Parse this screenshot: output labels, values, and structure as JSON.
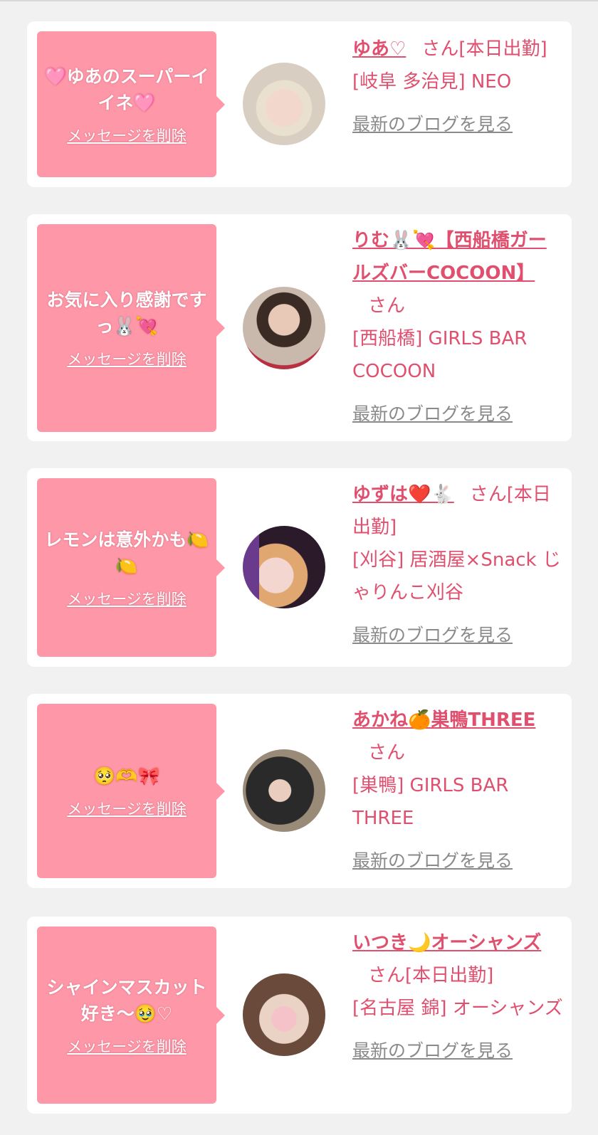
{
  "cards": [
    {
      "message": "🩷ゆあのスーパーイイネ🩷",
      "delete_label": "メッセージを削除",
      "name": "ゆあ♡",
      "suffix": "さん[本日出勤]",
      "shop": "[岐阜 多治見] NEO",
      "blog_label": "最新のブログを見る"
    },
    {
      "message": "お気に入り感謝ですっ🐰💘",
      "delete_label": "メッセージを削除",
      "name": "りむ🐰💘【西船橋ガールズバーCOCOON】",
      "suffix": "さん",
      "shop": "[西船橋] GIRLS BAR COCOON",
      "blog_label": "最新のブログを見る"
    },
    {
      "message": "レモンは意外かも🍋🍋",
      "delete_label": "メッセージを削除",
      "name": "ゆずは❤️🐇",
      "suffix": "さん[本日出勤]",
      "shop": "[刈谷] 居酒屋×Snack じゃりんこ刈谷",
      "blog_label": "最新のブログを見る"
    },
    {
      "message": "🥺🫶🎀",
      "delete_label": "メッセージを削除",
      "name": "あかね🍊巣鴨THREE",
      "suffix": "さん",
      "shop": "[巣鴨] GIRLS BAR THREE",
      "blog_label": "最新のブログを見る"
    },
    {
      "message": "シャインマスカット好き〜🥹♡",
      "delete_label": "メッセージを削除",
      "name": "いつき🌙オーシャンズ",
      "suffix": "さん[本日出勤]",
      "shop": "[名古屋 錦] オーシャンズ",
      "blog_label": "最新のブログを見る"
    }
  ]
}
